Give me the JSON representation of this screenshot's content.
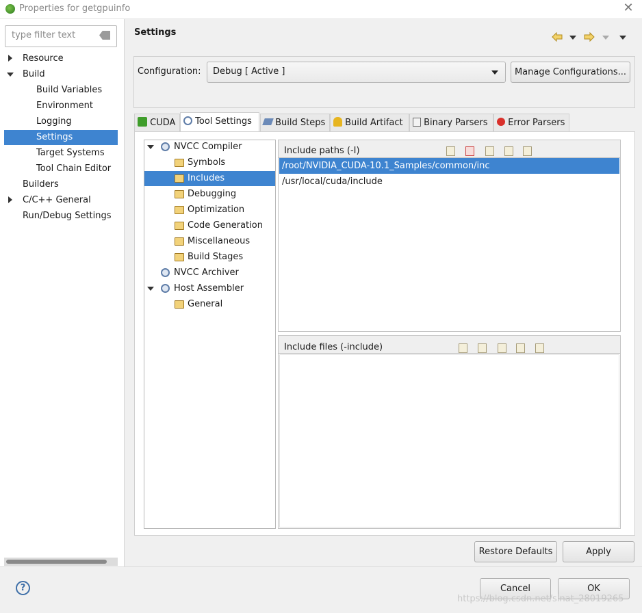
{
  "window": {
    "title": "Properties for getgpuinfo",
    "close_glyph": "✕"
  },
  "filter": {
    "placeholder": "type filter text"
  },
  "left_tree": {
    "items": [
      {
        "label": "Resource"
      },
      {
        "label": "Build"
      },
      {
        "label": "Build Variables"
      },
      {
        "label": "Environment"
      },
      {
        "label": "Logging"
      },
      {
        "label": "Settings"
      },
      {
        "label": "Target Systems"
      },
      {
        "label": "Tool Chain Editor"
      },
      {
        "label": "Builders"
      },
      {
        "label": "C/C++ General"
      },
      {
        "label": "Run/Debug Settings"
      }
    ],
    "selected": "Settings"
  },
  "page": {
    "title": "Settings"
  },
  "configuration": {
    "label": "Configuration:",
    "value": "Debug  [ Active ]",
    "manage_label": "Manage Configurations..."
  },
  "tabs": [
    {
      "label": "CUDA",
      "icon": "cuda-icon"
    },
    {
      "label": "Tool Settings",
      "icon": "tool-settings-icon"
    },
    {
      "label": "Build Steps",
      "icon": "build-steps-icon"
    },
    {
      "label": "Build Artifact",
      "icon": "build-artifact-icon"
    },
    {
      "label": "Binary Parsers",
      "icon": "binary-parsers-icon"
    },
    {
      "label": "Error Parsers",
      "icon": "error-parsers-icon"
    }
  ],
  "active_tab": "Tool Settings",
  "tool_tree": {
    "items": [
      {
        "label": "NVCC Compiler"
      },
      {
        "label": "Symbols"
      },
      {
        "label": "Includes"
      },
      {
        "label": "Debugging"
      },
      {
        "label": "Optimization"
      },
      {
        "label": "Code Generation"
      },
      {
        "label": "Miscellaneous"
      },
      {
        "label": "Build Stages"
      },
      {
        "label": "NVCC Archiver"
      },
      {
        "label": "Host Assembler"
      },
      {
        "label": "General"
      }
    ],
    "selected": "Includes"
  },
  "include_paths": {
    "title": "Include paths (-I)",
    "rows": [
      "/root/NVIDIA_CUDA-10.1_Samples/common/inc",
      "/usr/local/cuda/include"
    ],
    "selected_index": 0
  },
  "include_files": {
    "title": "Include files (-include)",
    "rows": []
  },
  "buttons": {
    "restore": "Restore Defaults",
    "apply": "Apply",
    "cancel": "Cancel",
    "ok": "OK",
    "help": "?"
  },
  "watermark": "https://blog.csdn.net/sinat_28019265",
  "colors": {
    "selection": "#3e84d0",
    "accent_green": "#2a7a1f"
  }
}
